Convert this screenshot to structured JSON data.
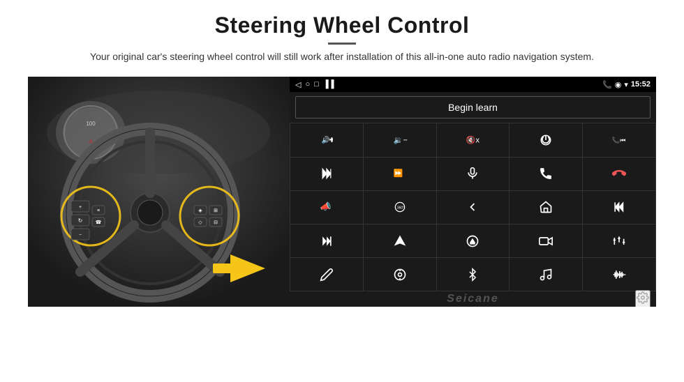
{
  "header": {
    "title": "Steering Wheel Control",
    "subtitle": "Your original car's steering wheel control will still work after installation of this all-in-one auto radio navigation system."
  },
  "status_bar": {
    "time": "15:52",
    "icons": [
      "back-arrow",
      "home-circle",
      "square-recent",
      "signal-bars"
    ]
  },
  "begin_learn": {
    "label": "Begin learn"
  },
  "controls": [
    {
      "icon": "vol-up",
      "symbol": "🔊+"
    },
    {
      "icon": "vol-down",
      "symbol": "🔉−"
    },
    {
      "icon": "vol-mute",
      "symbol": "🔇×"
    },
    {
      "icon": "power",
      "symbol": "⏻"
    },
    {
      "icon": "prev-track-phone",
      "symbol": "📞⏮"
    },
    {
      "icon": "next-track",
      "symbol": "⏭"
    },
    {
      "icon": "seek-forward-mute",
      "symbol": "⏩"
    },
    {
      "icon": "mic",
      "symbol": "🎤"
    },
    {
      "icon": "phone",
      "symbol": "📞"
    },
    {
      "icon": "hang-up",
      "symbol": "📵"
    },
    {
      "icon": "horn",
      "symbol": "📣"
    },
    {
      "icon": "360-view",
      "symbol": "360°"
    },
    {
      "icon": "back",
      "symbol": "↩"
    },
    {
      "icon": "home",
      "symbol": "⌂"
    },
    {
      "icon": "skip-back",
      "symbol": "⏮"
    },
    {
      "icon": "fast-forward",
      "symbol": "⏭"
    },
    {
      "icon": "navigation",
      "symbol": "➤"
    },
    {
      "icon": "eject",
      "symbol": "⏏"
    },
    {
      "icon": "camera",
      "symbol": "📷"
    },
    {
      "icon": "equalizer",
      "symbol": "⚙"
    },
    {
      "icon": "pen",
      "symbol": "✏"
    },
    {
      "icon": "dial",
      "symbol": "◎"
    },
    {
      "icon": "bluetooth",
      "symbol": "⚡"
    },
    {
      "icon": "music",
      "symbol": "🎵"
    },
    {
      "icon": "waveform",
      "symbol": "📊"
    }
  ],
  "watermark": "Seicane",
  "settings": {
    "icon": "gear-icon"
  }
}
